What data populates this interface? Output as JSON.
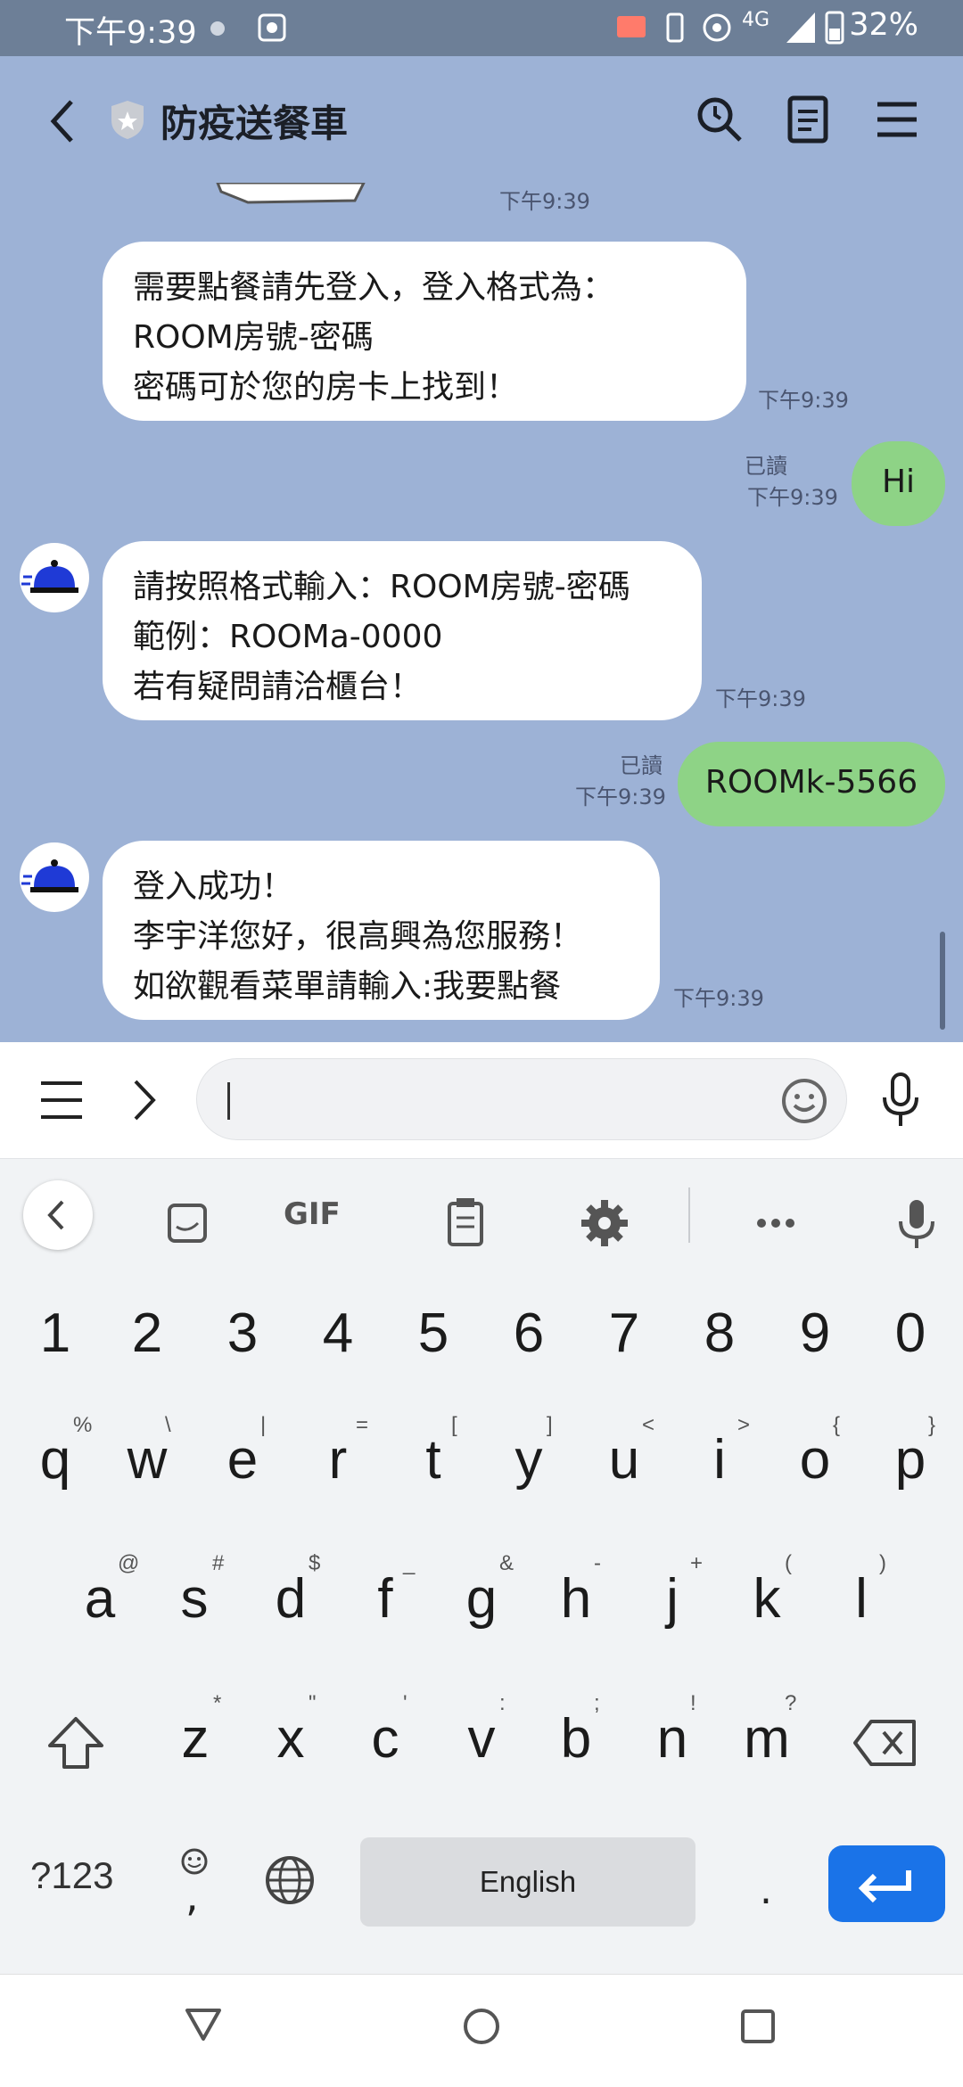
{
  "status_bar": {
    "time": "下午9:39",
    "battery": "32%",
    "network": "4G"
  },
  "header": {
    "title": "防疫送餐車",
    "icons": [
      "back-icon",
      "shield-icon",
      "search-icon",
      "notes-icon",
      "menu-icon"
    ]
  },
  "messages": [
    {
      "from": "bot",
      "text": "",
      "time": "下午9:39",
      "note": "partial image"
    },
    {
      "from": "bot",
      "text": "需要點餐請先登入，登入格式為：\nROOM房號-密碼\n密碼可於您的房卡上找到！",
      "time": "下午9:39"
    },
    {
      "from": "me",
      "text": "Hi",
      "read": "已讀",
      "time": "下午9:39"
    },
    {
      "from": "bot",
      "text": "請按照格式輸入：ROOM房號-密碼\n範例：ROOMa-0000\n若有疑問請洽櫃台！",
      "time": "下午9:39"
    },
    {
      "from": "me",
      "text": "ROOMk-5566",
      "read": "已讀",
      "time": "下午9:39"
    },
    {
      "from": "bot",
      "text": "登入成功！\n李宇洋您好，很高興為您服務！\n如欲觀看菜單請輸入:我要點餐",
      "time": "下午9:39"
    }
  ],
  "input": {
    "value": "",
    "placeholder": ""
  },
  "keyboard": {
    "numbers": [
      "1",
      "2",
      "3",
      "4",
      "5",
      "6",
      "7",
      "8",
      "9",
      "0"
    ],
    "row1": [
      "q",
      "w",
      "e",
      "r",
      "t",
      "y",
      "u",
      "i",
      "o",
      "p"
    ],
    "row1_hints": [
      "%",
      "\\",
      "|",
      "=",
      "[",
      "]",
      "<",
      ">",
      "{",
      "}"
    ],
    "row2": [
      "a",
      "s",
      "d",
      "f",
      "g",
      "h",
      "j",
      "k",
      "l"
    ],
    "row2_hints": [
      "@",
      "#",
      "$",
      "_",
      "&",
      "-",
      "+",
      "(",
      ")"
    ],
    "row3": [
      "z",
      "x",
      "c",
      "v",
      "b",
      "n",
      "m"
    ],
    "row3_hints": [
      "*",
      "\"",
      "'",
      ":",
      ";",
      "!",
      "?"
    ],
    "symbols_label": "?123",
    "comma": ",",
    "period": ".",
    "space_label": "English",
    "gif_label": "GIF",
    "accent_color": "#1a73e8"
  }
}
